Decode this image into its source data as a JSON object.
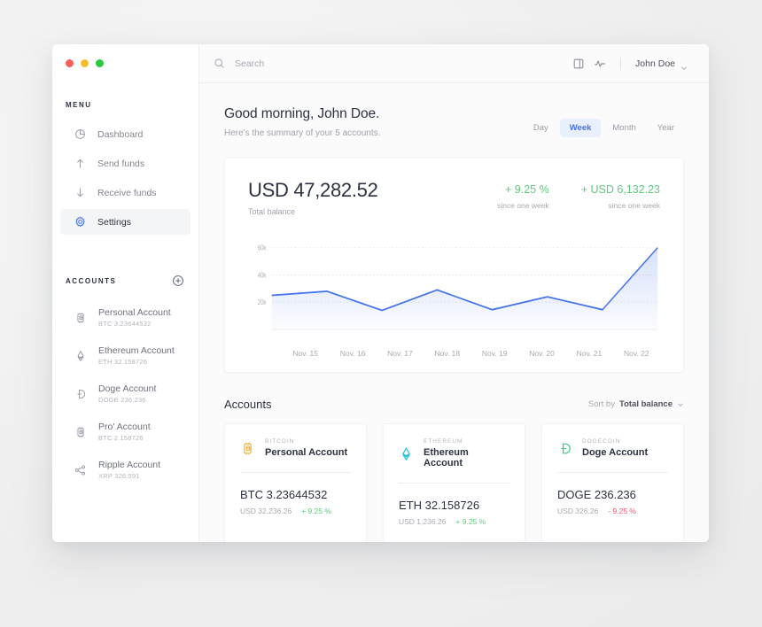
{
  "window": {
    "traffic_lights": [
      "close",
      "minimize",
      "maximize"
    ]
  },
  "topbar": {
    "search_placeholder": "Search",
    "search_value": "",
    "icons": [
      "search-icon",
      "device-icon",
      "activity-icon"
    ],
    "user_name": "John Doe"
  },
  "sidebar": {
    "menu_label": "MENU",
    "items": [
      {
        "label": "Dashboard",
        "icon": "pie-chart-icon",
        "active": false
      },
      {
        "label": "Send funds",
        "icon": "arrow-up-icon",
        "active": false
      },
      {
        "label": "Receive funds",
        "icon": "arrow-down-icon",
        "active": false
      },
      {
        "label": "Settings",
        "icon": "gear-icon",
        "active": true
      }
    ],
    "accounts_label": "ACCOUNTS",
    "add_icon": "plus-circle-icon",
    "accounts": [
      {
        "name": "Personal Account",
        "balance": "BTC 3.23644532",
        "icon": "bitcoin-icon"
      },
      {
        "name": "Ethereum Account",
        "balance": "ETH 32.158726",
        "icon": "ethereum-icon"
      },
      {
        "name": "Doge Account",
        "balance": "DOGE 236.236",
        "icon": "dogecoin-icon"
      },
      {
        "name": "Pro' Account",
        "balance": "BTC 2.158726",
        "icon": "bitcoin-icon"
      },
      {
        "name": "Ripple Account",
        "balance": "XRP 326.591",
        "icon": "ripple-icon"
      }
    ]
  },
  "greeting": {
    "title": "Good morning, John Doe.",
    "subtitle": "Here's the summary of your 5 accounts."
  },
  "period_tabs": [
    {
      "label": "Day",
      "active": false
    },
    {
      "label": "Week",
      "active": true
    },
    {
      "label": "Month",
      "active": false
    },
    {
      "label": "Year",
      "active": false
    }
  ],
  "balance": {
    "amount": "USD 47,282.52",
    "label": "Total balance",
    "stats": [
      {
        "value": "+ 9.25 %",
        "sub": "since one week",
        "direction": "up"
      },
      {
        "value": "+ USD 6,132.23",
        "sub": "since one week",
        "direction": "up"
      }
    ]
  },
  "chart_data": {
    "type": "area",
    "title": "",
    "xlabel": "",
    "ylabel": "",
    "categories": [
      "Nov. 15",
      "Nov. 16",
      "Nov. 17",
      "Nov. 18",
      "Nov. 19",
      "Nov. 20",
      "Nov. 21",
      "Nov. 22"
    ],
    "values": [
      25000,
      28000,
      14000,
      29000,
      14500,
      24000,
      14500,
      60000
    ],
    "ytick_labels": [
      "20k",
      "40k",
      "60k"
    ],
    "yticks": [
      20000,
      40000,
      60000
    ],
    "ylim": [
      0,
      65000
    ],
    "grid": true,
    "legend": "none",
    "line_color": "#4574e8",
    "fill_color": "#e8effd"
  },
  "accounts_section": {
    "title": "Accounts",
    "sort_prefix": "Sort by",
    "sort_value": "Total balance",
    "cards": [
      {
        "symbol": "BITCOIN",
        "name": "Personal Account",
        "amount": "BTC 3.23644532",
        "fiat": "USD 32,236.26",
        "change": "+ 9.25 %",
        "direction": "up",
        "icon": "bitcoin-icon",
        "color": "#f7b33e"
      },
      {
        "symbol": "ETHEREUM",
        "name": "Ethereum Account",
        "amount": "ETH 32.158726",
        "fiat": "USD 1,236.26",
        "change": "+ 9.25 %",
        "direction": "up",
        "icon": "ethereum-icon",
        "color": "#20c4e0"
      },
      {
        "symbol": "DOGECOIN",
        "name": "Doge Account",
        "amount": "DOGE 236.236",
        "fiat": "USD 326.26",
        "change": "- 9.25 %",
        "direction": "down",
        "icon": "dogecoin-icon",
        "color": "#3ecb8c"
      }
    ]
  },
  "colors": {
    "accent": "#4574e8",
    "positive": "#5fc97f",
    "negative": "#f2566a",
    "text_dark": "#2c3241",
    "text_muted": "#a1a3ac"
  }
}
